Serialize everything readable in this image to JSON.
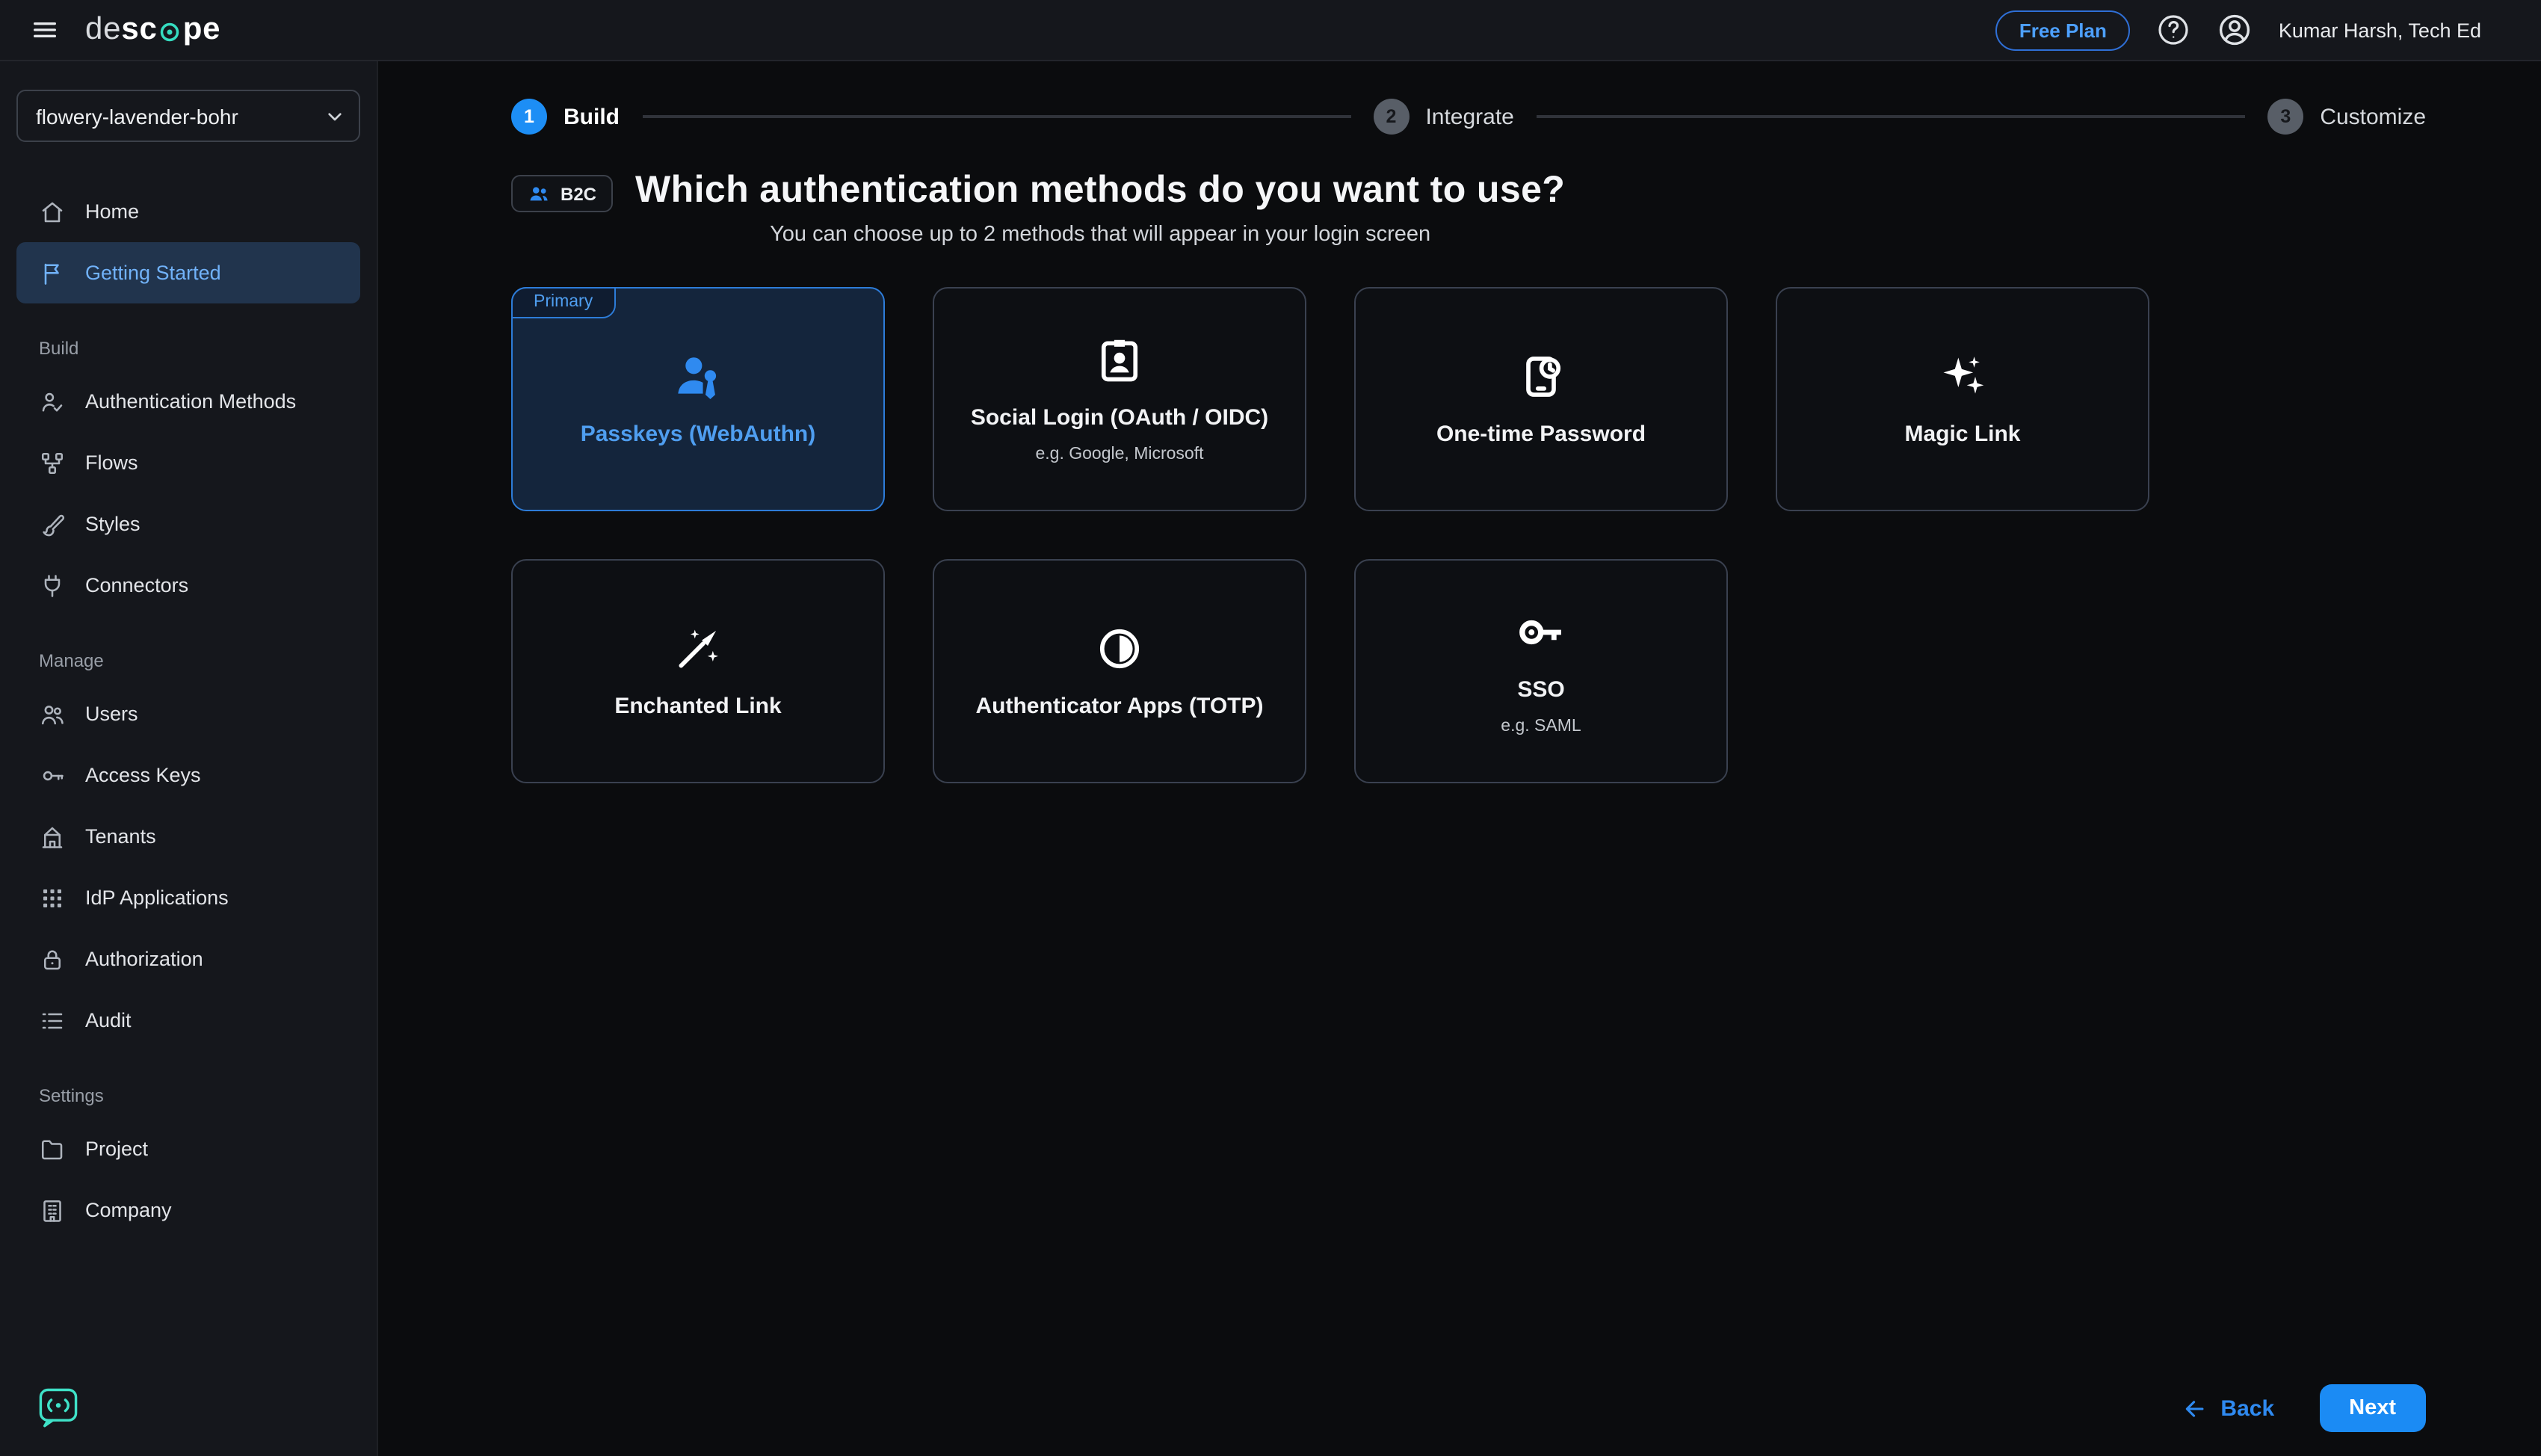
{
  "topbar": {
    "logo": {
      "de": "de",
      "sc": "sc",
      "pe": "pe"
    },
    "free_plan": "Free Plan",
    "user": "Kumar Harsh, Tech Ed"
  },
  "sidebar": {
    "project": "flowery-lavender-bohr",
    "sections": {
      "build": "Build",
      "manage": "Manage",
      "settings": "Settings"
    },
    "nav": {
      "home": "Home",
      "getting_started": "Getting Started",
      "auth_methods": "Authentication Methods",
      "flows": "Flows",
      "styles": "Styles",
      "connectors": "Connectors",
      "users": "Users",
      "access_keys": "Access Keys",
      "tenants": "Tenants",
      "idp_applications": "IdP Applications",
      "authorization": "Authorization",
      "audit": "Audit",
      "project": "Project",
      "company": "Company"
    }
  },
  "stepper": {
    "steps": [
      {
        "num": "1",
        "label": "Build",
        "state": "active"
      },
      {
        "num": "2",
        "label": "Integrate",
        "state": "upcoming"
      },
      {
        "num": "3",
        "label": "Customize",
        "state": "upcoming"
      }
    ]
  },
  "content": {
    "segment_badge": "B2C",
    "title": "Which authentication methods do you want to use?",
    "subtitle": "You can choose up to 2 methods that will appear in your login screen",
    "primary_tag": "Primary",
    "cards": [
      {
        "label": "Passkeys (WebAuthn)",
        "sub": "",
        "selected": true
      },
      {
        "label": "Social Login (OAuth / OIDC)",
        "sub": "e.g. Google, Microsoft",
        "selected": false
      },
      {
        "label": "One-time Password",
        "sub": "",
        "selected": false
      },
      {
        "label": "Magic Link",
        "sub": "",
        "selected": false
      },
      {
        "label": "Enchanted Link",
        "sub": "",
        "selected": false
      },
      {
        "label": "Authenticator Apps (TOTP)",
        "sub": "",
        "selected": false
      },
      {
        "label": "SSO",
        "sub": "e.g. SAML",
        "selected": false
      }
    ],
    "back": "Back",
    "next": "Next"
  },
  "colors": {
    "accent_blue": "#1d8ef5",
    "logo_teal": "#35dcc0",
    "selected_card_border": "#2d7cd8",
    "selected_card_bg": "#14253c",
    "active_nav_bg": "#21344d"
  }
}
